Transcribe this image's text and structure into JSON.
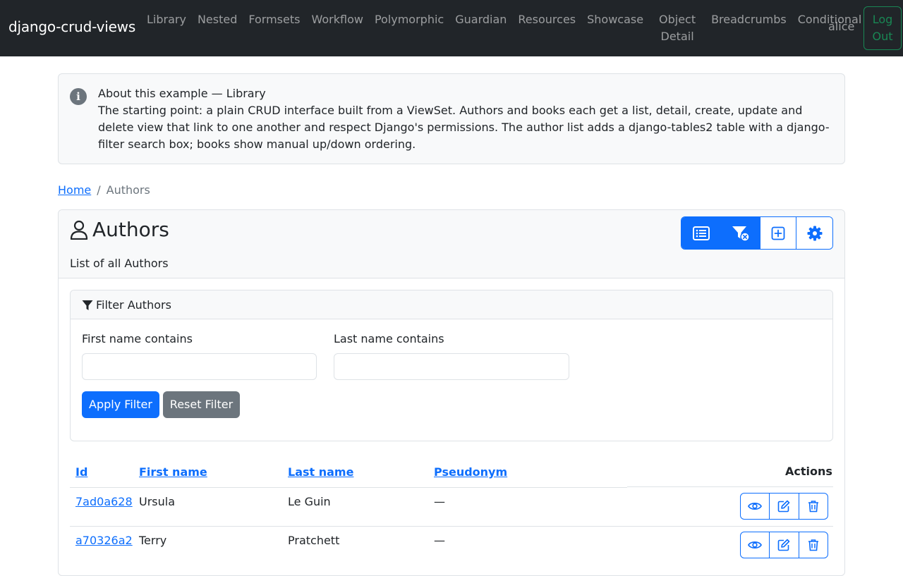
{
  "navbar": {
    "brand": "django-crud-views",
    "items": [
      "Library",
      "Nested",
      "Formsets",
      "Workflow",
      "Polymorphic",
      "Guardian",
      "Resources",
      "Showcase"
    ],
    "object_detail_1": "Object",
    "object_detail_2": "Detail",
    "items_after": [
      "Breadcrumbs",
      "Conditional"
    ],
    "user": "alice",
    "logout_1": "Log",
    "logout_2": "Out"
  },
  "info": {
    "icon": "info-icon",
    "title": "About this example — Library",
    "text": "The starting point: a plain CRUD interface built from a ViewSet. Authors and books each get a list, detail, create, update and delete view that link to one another and respect Django's permissions. The author list adds a django-tables2 table with a django-filter search box; books show manual up/down ordering."
  },
  "breadcrumb": {
    "home": "Home",
    "separator": "/",
    "current": "Authors"
  },
  "card": {
    "title": "Authors",
    "subtitle": "List of all Authors",
    "toolbar_icons": [
      "list-icon",
      "filter-clear-icon",
      "plus-square-icon",
      "gear-icon"
    ]
  },
  "filter": {
    "title": "Filter Authors",
    "first_name_label": "First name contains",
    "first_name_value": "",
    "last_name_label": "Last name contains",
    "last_name_value": "",
    "apply_label": "Apply Filter",
    "reset_label": "Reset Filter"
  },
  "table": {
    "headers": {
      "id": "Id",
      "first_name": "First name",
      "last_name": "Last name",
      "pseudonym": "Pseudonym",
      "actions": "Actions"
    },
    "rows": [
      {
        "id": "7ad0a628",
        "first_name": "Ursula",
        "last_name": "Le Guin",
        "pseudonym": "—"
      },
      {
        "id": "a70326a2",
        "first_name": "Terry",
        "last_name": "Pratchett",
        "pseudonym": "—"
      }
    ],
    "action_icons": [
      "eye-icon",
      "edit-icon",
      "trash-icon"
    ]
  },
  "colors": {
    "primary": "#0d6efd",
    "secondary": "#6c757d",
    "success": "#198754",
    "navbar": "#212529"
  }
}
